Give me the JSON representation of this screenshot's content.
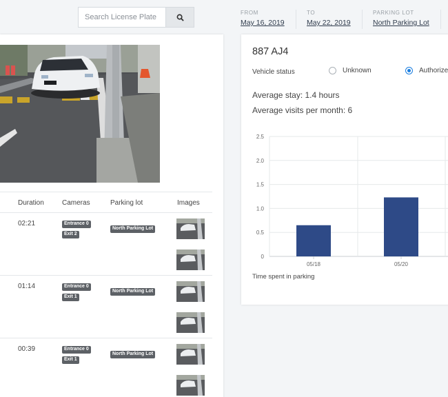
{
  "search": {
    "placeholder": "Search License Plate"
  },
  "filters": [
    {
      "label": "FROM",
      "value": "May 16, 2019"
    },
    {
      "label": "TO",
      "value": "May 22, 2019"
    },
    {
      "label": "PARKING LOT",
      "value": "North Parking Lot"
    }
  ],
  "table": {
    "columns": [
      "Duration",
      "Cameras",
      "Parking lot",
      "Images"
    ],
    "rows": [
      {
        "duration": "02:21",
        "cameras": [
          "Entrance 0",
          "Exit 2"
        ],
        "lot": "North Parking Lot"
      },
      {
        "duration": "01:14",
        "cameras": [
          "Entrance 0",
          "Exit 1"
        ],
        "lot": "North Parking Lot"
      },
      {
        "duration": "00:39",
        "cameras": [
          "Entrance 0",
          "Exit 1"
        ],
        "lot": "North Parking Lot"
      }
    ]
  },
  "vehicle": {
    "plate": "887 AJ4",
    "status_label": "Vehicle status",
    "status_options": [
      "Unknown",
      "Authorized"
    ],
    "status_selected": "Authorized",
    "avg_stay": "Average stay: 1.4 hours",
    "avg_visits": "Average visits per month: 6"
  },
  "chart_data": {
    "type": "bar",
    "categories": [
      "05/18",
      "05/20"
    ],
    "values": [
      0.65,
      1.23
    ],
    "ylim": [
      0,
      2.5
    ],
    "yticks": [
      "0",
      "0.5",
      "1.0",
      "1.5",
      "2.0",
      "2.5"
    ],
    "xlabel": "Time spent in parking",
    "color": "#2e4a87",
    "grid": true
  },
  "colors": {
    "accent": "#1b7ee0",
    "bar": "#2e4a87",
    "tag": "#5d6166"
  }
}
